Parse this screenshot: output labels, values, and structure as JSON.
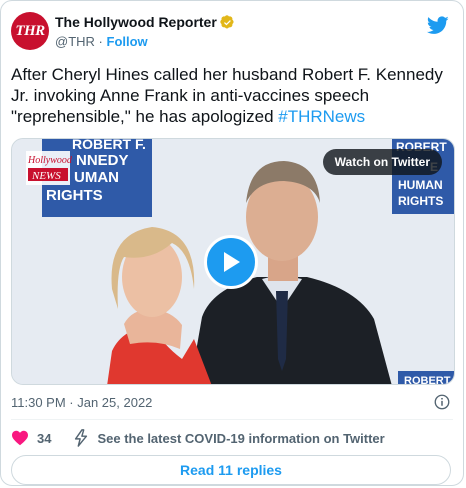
{
  "account": {
    "avatar_text": "THR",
    "name": "The Hollywood Reporter",
    "handle": "@THR",
    "separator": "·",
    "follow_label": "Follow"
  },
  "tweet": {
    "text": "After Cheryl Hines called her husband Robert F. Kennedy Jr. invoking Anne Frank in anti-vaccines speech \"reprehensible,\" he has apologized ",
    "hashtag": "#THRNews"
  },
  "media": {
    "watch_label": "Watch on Twitter",
    "logo_text_top": "Hollywood",
    "logo_text_bottom": "NEWS",
    "backdrop_left": [
      "ROBERT F.",
      "NNEDY",
      "UMAN",
      "RIGHTS"
    ],
    "backdrop_right": [
      "ROBERT",
      "E",
      "HUMAN",
      "RIGHTS"
    ],
    "backdrop_bottom": "ROBERT"
  },
  "meta": {
    "time": "11:30 PM · Jan 25, 2022"
  },
  "actions": {
    "like_count": "34",
    "covid_label": "See the latest COVID-19 information on Twitter"
  },
  "replies": {
    "label": "Read 11 replies"
  },
  "colors": {
    "accent": "#1d9bf0",
    "like": "#f91880",
    "brand": "#c8102e"
  }
}
